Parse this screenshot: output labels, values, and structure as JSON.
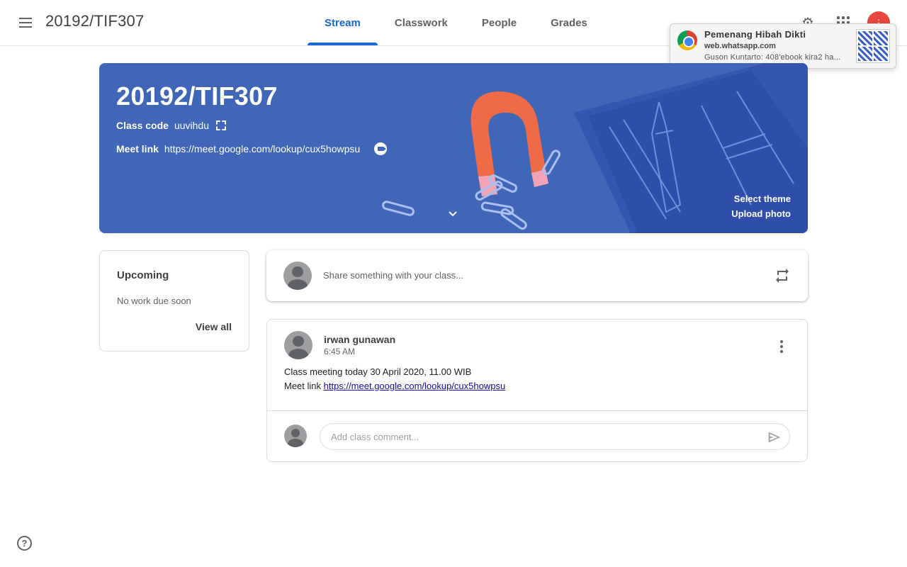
{
  "header": {
    "class_title": "20192/TIF307",
    "tabs": [
      {
        "label": "Stream",
        "active": true
      },
      {
        "label": "Classwork",
        "active": false
      },
      {
        "label": "People",
        "active": false
      },
      {
        "label": "Grades",
        "active": false
      }
    ]
  },
  "notification": {
    "title": "Pemenang Hibah Dikti",
    "site": "web.whatsapp.com",
    "body": "Guson Kuntarto: 408'ebook kira2 ha..."
  },
  "banner": {
    "title": "20192/TIF307",
    "class_code_label": "Class code",
    "class_code": "uuvihdu",
    "meet_label": "Meet link",
    "meet_link": "https://meet.google.com/lookup/cux5howpsu",
    "select_theme": "Select theme",
    "upload_photo": "Upload photo",
    "color": "#4066b8"
  },
  "upcoming": {
    "title": "Upcoming",
    "subtitle": "No work due soon",
    "link": "View all"
  },
  "share": {
    "placeholder": "Share something with your class..."
  },
  "post": {
    "author": "irwan gunawan",
    "time": "6:45 AM",
    "line1": "Class meeting today 30 April 2020, 11.00 WIB",
    "line2_prefix": "Meet link",
    "line2_link": "https://meet.google.com/lookup/cux5howpsu",
    "comment_placeholder": "Add class comment..."
  },
  "colors": {
    "accent": "#1967d2",
    "avatar_top": "#e8453c"
  }
}
